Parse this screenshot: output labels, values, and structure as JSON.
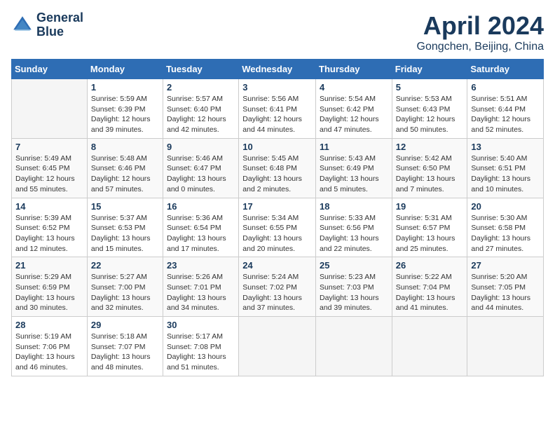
{
  "header": {
    "logo_line1": "General",
    "logo_line2": "Blue",
    "title": "April 2024",
    "location": "Gongchen, Beijing, China"
  },
  "days_of_week": [
    "Sunday",
    "Monday",
    "Tuesday",
    "Wednesday",
    "Thursday",
    "Friday",
    "Saturday"
  ],
  "weeks": [
    [
      {
        "day": "",
        "info": ""
      },
      {
        "day": "1",
        "info": "Sunrise: 5:59 AM\nSunset: 6:39 PM\nDaylight: 12 hours\nand 39 minutes."
      },
      {
        "day": "2",
        "info": "Sunrise: 5:57 AM\nSunset: 6:40 PM\nDaylight: 12 hours\nand 42 minutes."
      },
      {
        "day": "3",
        "info": "Sunrise: 5:56 AM\nSunset: 6:41 PM\nDaylight: 12 hours\nand 44 minutes."
      },
      {
        "day": "4",
        "info": "Sunrise: 5:54 AM\nSunset: 6:42 PM\nDaylight: 12 hours\nand 47 minutes."
      },
      {
        "day": "5",
        "info": "Sunrise: 5:53 AM\nSunset: 6:43 PM\nDaylight: 12 hours\nand 50 minutes."
      },
      {
        "day": "6",
        "info": "Sunrise: 5:51 AM\nSunset: 6:44 PM\nDaylight: 12 hours\nand 52 minutes."
      }
    ],
    [
      {
        "day": "7",
        "info": "Sunrise: 5:49 AM\nSunset: 6:45 PM\nDaylight: 12 hours\nand 55 minutes."
      },
      {
        "day": "8",
        "info": "Sunrise: 5:48 AM\nSunset: 6:46 PM\nDaylight: 12 hours\nand 57 minutes."
      },
      {
        "day": "9",
        "info": "Sunrise: 5:46 AM\nSunset: 6:47 PM\nDaylight: 13 hours\nand 0 minutes."
      },
      {
        "day": "10",
        "info": "Sunrise: 5:45 AM\nSunset: 6:48 PM\nDaylight: 13 hours\nand 2 minutes."
      },
      {
        "day": "11",
        "info": "Sunrise: 5:43 AM\nSunset: 6:49 PM\nDaylight: 13 hours\nand 5 minutes."
      },
      {
        "day": "12",
        "info": "Sunrise: 5:42 AM\nSunset: 6:50 PM\nDaylight: 13 hours\nand 7 minutes."
      },
      {
        "day": "13",
        "info": "Sunrise: 5:40 AM\nSunset: 6:51 PM\nDaylight: 13 hours\nand 10 minutes."
      }
    ],
    [
      {
        "day": "14",
        "info": "Sunrise: 5:39 AM\nSunset: 6:52 PM\nDaylight: 13 hours\nand 12 minutes."
      },
      {
        "day": "15",
        "info": "Sunrise: 5:37 AM\nSunset: 6:53 PM\nDaylight: 13 hours\nand 15 minutes."
      },
      {
        "day": "16",
        "info": "Sunrise: 5:36 AM\nSunset: 6:54 PM\nDaylight: 13 hours\nand 17 minutes."
      },
      {
        "day": "17",
        "info": "Sunrise: 5:34 AM\nSunset: 6:55 PM\nDaylight: 13 hours\nand 20 minutes."
      },
      {
        "day": "18",
        "info": "Sunrise: 5:33 AM\nSunset: 6:56 PM\nDaylight: 13 hours\nand 22 minutes."
      },
      {
        "day": "19",
        "info": "Sunrise: 5:31 AM\nSunset: 6:57 PM\nDaylight: 13 hours\nand 25 minutes."
      },
      {
        "day": "20",
        "info": "Sunrise: 5:30 AM\nSunset: 6:58 PM\nDaylight: 13 hours\nand 27 minutes."
      }
    ],
    [
      {
        "day": "21",
        "info": "Sunrise: 5:29 AM\nSunset: 6:59 PM\nDaylight: 13 hours\nand 30 minutes."
      },
      {
        "day": "22",
        "info": "Sunrise: 5:27 AM\nSunset: 7:00 PM\nDaylight: 13 hours\nand 32 minutes."
      },
      {
        "day": "23",
        "info": "Sunrise: 5:26 AM\nSunset: 7:01 PM\nDaylight: 13 hours\nand 34 minutes."
      },
      {
        "day": "24",
        "info": "Sunrise: 5:24 AM\nSunset: 7:02 PM\nDaylight: 13 hours\nand 37 minutes."
      },
      {
        "day": "25",
        "info": "Sunrise: 5:23 AM\nSunset: 7:03 PM\nDaylight: 13 hours\nand 39 minutes."
      },
      {
        "day": "26",
        "info": "Sunrise: 5:22 AM\nSunset: 7:04 PM\nDaylight: 13 hours\nand 41 minutes."
      },
      {
        "day": "27",
        "info": "Sunrise: 5:20 AM\nSunset: 7:05 PM\nDaylight: 13 hours\nand 44 minutes."
      }
    ],
    [
      {
        "day": "28",
        "info": "Sunrise: 5:19 AM\nSunset: 7:06 PM\nDaylight: 13 hours\nand 46 minutes."
      },
      {
        "day": "29",
        "info": "Sunrise: 5:18 AM\nSunset: 7:07 PM\nDaylight: 13 hours\nand 48 minutes."
      },
      {
        "day": "30",
        "info": "Sunrise: 5:17 AM\nSunset: 7:08 PM\nDaylight: 13 hours\nand 51 minutes."
      },
      {
        "day": "",
        "info": ""
      },
      {
        "day": "",
        "info": ""
      },
      {
        "day": "",
        "info": ""
      },
      {
        "day": "",
        "info": ""
      }
    ]
  ]
}
